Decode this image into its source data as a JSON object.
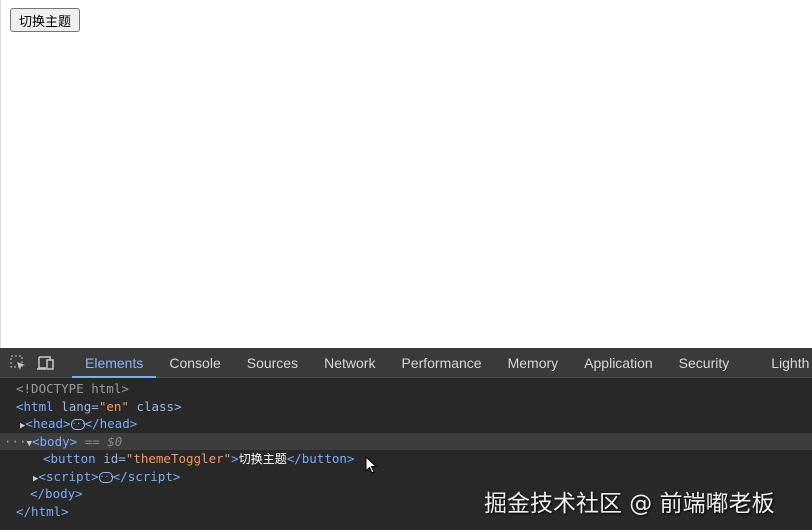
{
  "page": {
    "button_label": "切换主题"
  },
  "devtools": {
    "tabs": [
      "Elements",
      "Console",
      "Sources",
      "Network",
      "Performance",
      "Memory",
      "Application",
      "Security",
      "Lighth"
    ],
    "active_tab": "Elements",
    "tree": {
      "doctype": "<!DOCTYPE html>",
      "html_open": "<html",
      "lang_attr": "lang=",
      "lang_val": "\"en\"",
      "class_attr": "class>",
      "head_open": "<head>",
      "head_close": "</head>",
      "ellipsis": "···",
      "body_open": "<body>",
      "body_ref": "== $0",
      "button_open": "<button",
      "id_attr": "id=",
      "id_val": "\"themeToggler\"",
      "button_gt": ">",
      "button_text": "切换主题",
      "button_close": "</button>",
      "script_open": "<script>",
      "script_close": "</script>",
      "body_close": "</body>",
      "html_close": "</html>",
      "row_dots": "···"
    }
  },
  "watermark": "掘金技术社区 @ 前端嘟老板"
}
